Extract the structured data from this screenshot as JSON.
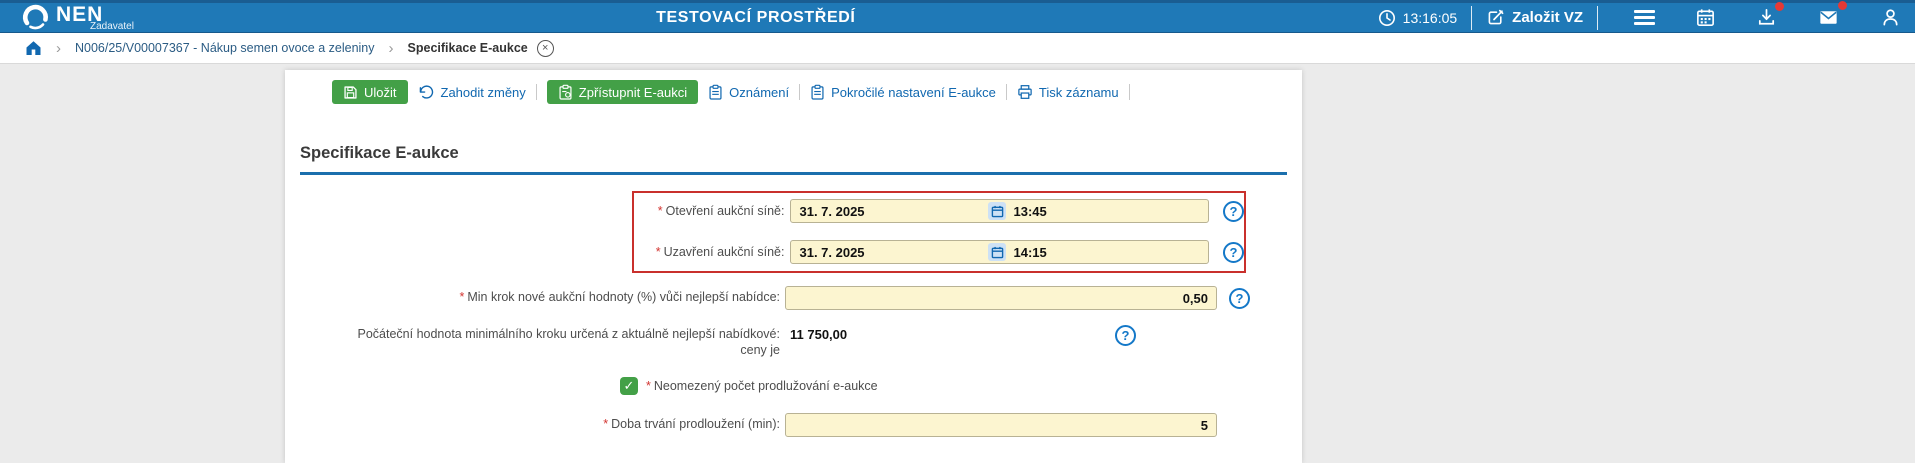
{
  "header": {
    "logo_text": "NEN",
    "logo_subtext": "Zadavatel",
    "environment_title": "TESTOVACÍ PROSTŘEDÍ",
    "time": "13:16:05",
    "create_vz_label": "Založit VZ"
  },
  "breadcrumb": {
    "procurement": "N006/25/V00007367 - Nákup semen ovoce a zeleniny",
    "current": "Specifikace E-aukce"
  },
  "toolbar": {
    "save_label": "Uložit",
    "discard_label": "Zahodit změny",
    "publish_label": "Zpřístupnit E-aukci",
    "announcement_label": "Oznámení",
    "advanced_label": "Pokročilé nastavení E-aukce",
    "print_label": "Tisk záznamu"
  },
  "section": {
    "title": "Specifikace E-aukce"
  },
  "form": {
    "required_mark": "*",
    "open_room": {
      "label": "Otevření aukční síně:",
      "date": "31. 7. 2025",
      "time": "13:45"
    },
    "close_room": {
      "label": "Uzavření aukční síně:",
      "date": "31. 7. 2025",
      "time": "14:15"
    },
    "min_step": {
      "label": "Min krok nové aukční hodnoty (%) vůči nejlepší nabídce:",
      "value": "0,50"
    },
    "initial_step": {
      "label_line1": "Počáteční hodnota minimálního kroku určená z aktuálně nejlepší nabídkové:",
      "label_line2": "ceny je",
      "value": "11 750,00"
    },
    "unlimited_extensions": {
      "label": "Neomezený počet prodlužování e-aukce",
      "checked": true,
      "check_glyph": "✓"
    },
    "extension_duration": {
      "label": "Doba trvání prodloužení (min):",
      "value": "5"
    }
  },
  "colors": {
    "header_blue": "#1f79b7",
    "link_blue": "#1168b0",
    "button_green": "#43a047",
    "field_yellow": "#fcf5d0",
    "highlight_red": "#c9302c",
    "badge_red": "#e53935"
  }
}
